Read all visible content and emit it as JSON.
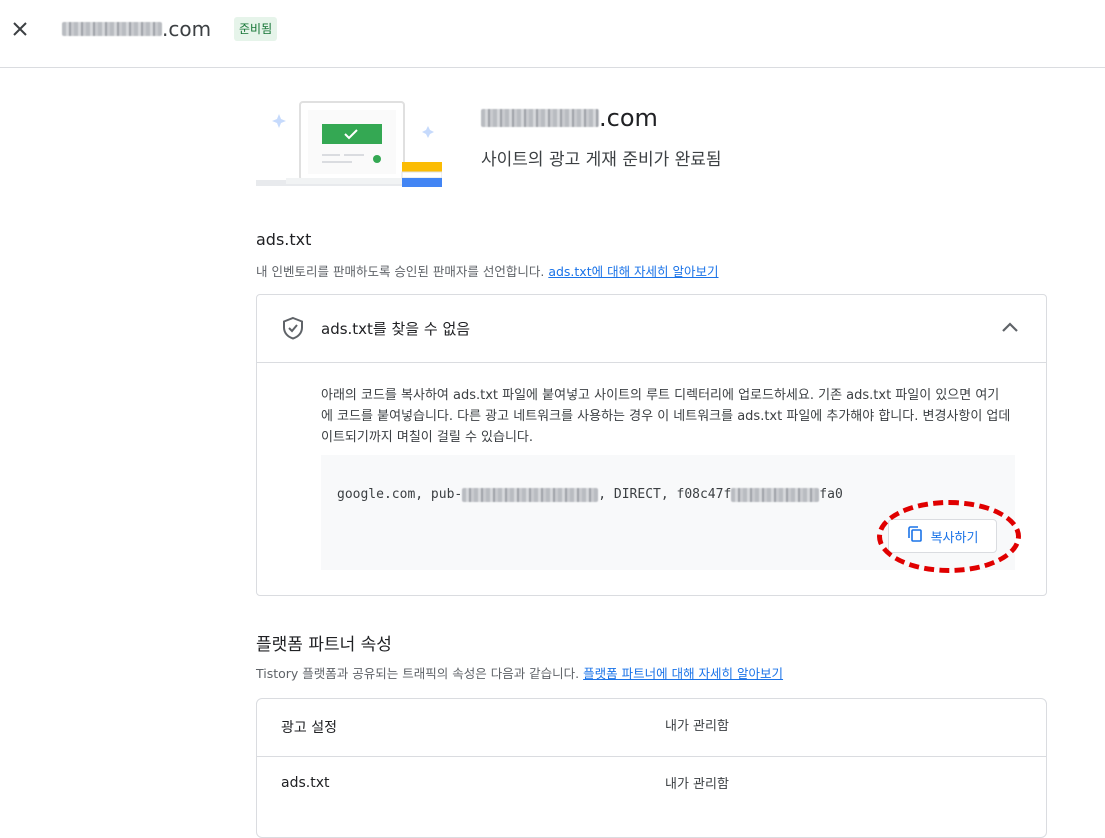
{
  "header": {
    "site_suffix": ".com",
    "status": "준비됨",
    "close_icon": "close-icon"
  },
  "hero": {
    "domain_suffix": ".com",
    "subtitle": "사이트의 광고 게재 준비가 완료됨"
  },
  "ads_txt": {
    "title": "ads.txt",
    "description": "내 인벤토리를 판매하도록 승인된 판매자를 선언합니다. ",
    "learn_more": "ads.txt에 대해 자세히 알아보기",
    "card": {
      "header": "ads.txt를 찾을 수 없음",
      "body": "아래의 코드를 복사하여 ads.txt 파일에 붙여넣고 사이트의 루트 디렉터리에 업로드하세요. 기존 ads.txt 파일이 있으면 여기에 코드를 붙여넣습니다. 다른 광고 네트워크를 사용하는 경우 이 네트워크를 ads.txt 파일에 추가해야 합니다. 변경사항이 업데이트되기까지 며칠이 걸릴 수 있습니다.",
      "code_prefix": "google.com, pub-",
      "code_middle": ", DIRECT, f08c47f",
      "code_suffix": "fa0",
      "copy_label": "복사하기"
    }
  },
  "platform": {
    "title": "플랫폼 파트너 속성",
    "description": "Tistory 플랫폼과 공유되는 트래픽의 속성은 다음과 같습니다. ",
    "learn_more": "플랫폼 파트너에 대해 자세히 알아보기",
    "rows": [
      {
        "key": "광고 설정",
        "value": "내가 관리함"
      },
      {
        "key": "ads.txt",
        "value": "내가 관리함"
      }
    ]
  },
  "colors": {
    "accent": "#1a73e8",
    "status_bg": "#e6f4ea",
    "status_fg": "#137333",
    "annotation": "#e00000"
  }
}
